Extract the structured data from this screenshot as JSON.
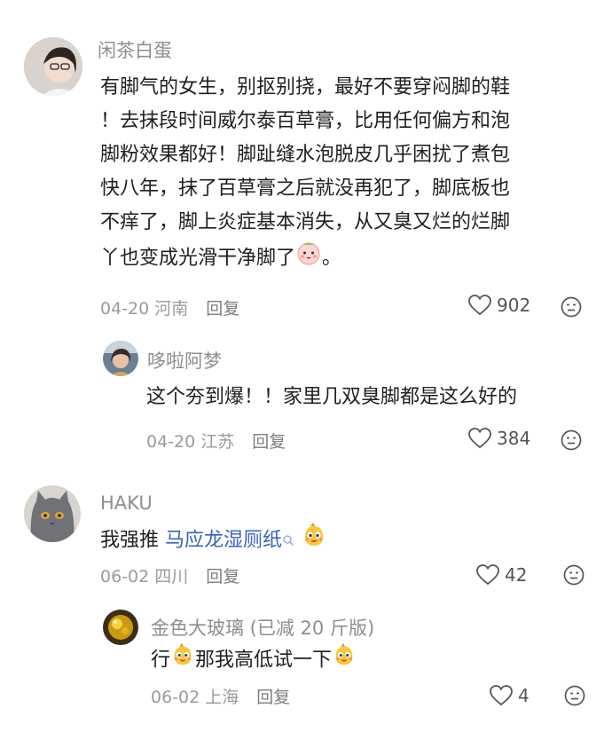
{
  "comments": [
    {
      "user": "闲茶白蛋",
      "lines": [
        "有脚气的女生，别抠别挠，最好不要穿闷脚的鞋",
        "！去抹段时间威尔泰百草膏，比用任何偏方和泡",
        "脚粉效果都好！脚趾缝水泡脱皮几乎困扰了煮包",
        "快八年，抹了百草膏之后就没再犯了，脚底板也",
        "不痒了，脚上炎症基本消失，从又臭又烂的烂脚",
        "丫也变成光滑干净脚了"
      ],
      "line_end": "。",
      "meta": "04-20 河南",
      "reply_label": "回复",
      "likes": "902"
    },
    {
      "user": "哆啦阿梦",
      "text": "这个夯到爆！！家里几双臭脚都是这么好的",
      "meta": "04-20 江苏",
      "reply_label": "回复",
      "likes": "384"
    },
    {
      "user": "HAKU",
      "text_prefix": "我强推",
      "link": "马应龙湿厕纸",
      "meta": "06-02 四川",
      "reply_label": "回复",
      "likes": "42"
    },
    {
      "user": "金色大玻璃 (已减 20 斤版)",
      "text_a": "行",
      "text_b": "那我高低试一下",
      "meta": "06-02 上海",
      "reply_label": "回复",
      "likes": "4"
    }
  ],
  "colors": {
    "link": "#3a64b8",
    "meta": "#9a9a9a",
    "name": "#8e8e8e"
  },
  "icons": [
    "heart-icon",
    "dislike-face-icon",
    "search-icon",
    "blush-emoji",
    "mascot-emoji"
  ]
}
